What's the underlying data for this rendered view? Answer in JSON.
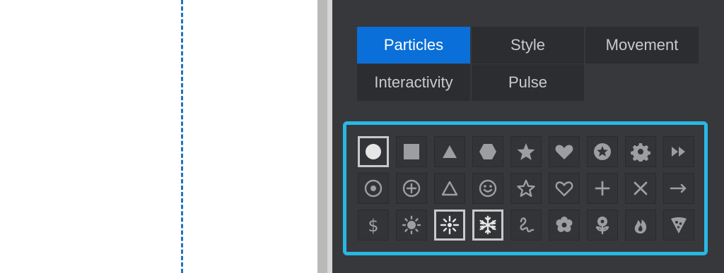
{
  "panel": {
    "tabs": [
      {
        "label": "Particles",
        "active": true
      },
      {
        "label": "Style",
        "active": false
      },
      {
        "label": "Movement",
        "active": false
      },
      {
        "label": "Interactivity",
        "active": false
      },
      {
        "label": "Pulse",
        "active": false
      }
    ],
    "accent_color": "#0a6fd8",
    "grid_border_color": "#29b8e4",
    "shapes": [
      [
        "circle",
        "square",
        "triangle",
        "hexagon",
        "star",
        "heart",
        "star-badge",
        "gear",
        "fast-forward"
      ],
      [
        "circle-dot",
        "circle-plus",
        "triangle-outline",
        "smiley",
        "star-outline",
        "heart-outline",
        "plus",
        "cross",
        "arrow-right"
      ],
      [
        "dollar",
        "sun",
        "sparkle",
        "snowflake",
        "squiggle",
        "flower",
        "rose",
        "flame",
        "pizza-slice"
      ]
    ],
    "selected_shapes": [
      "circle",
      "sparkle",
      "snowflake"
    ],
    "dollar_glyph": "$"
  }
}
